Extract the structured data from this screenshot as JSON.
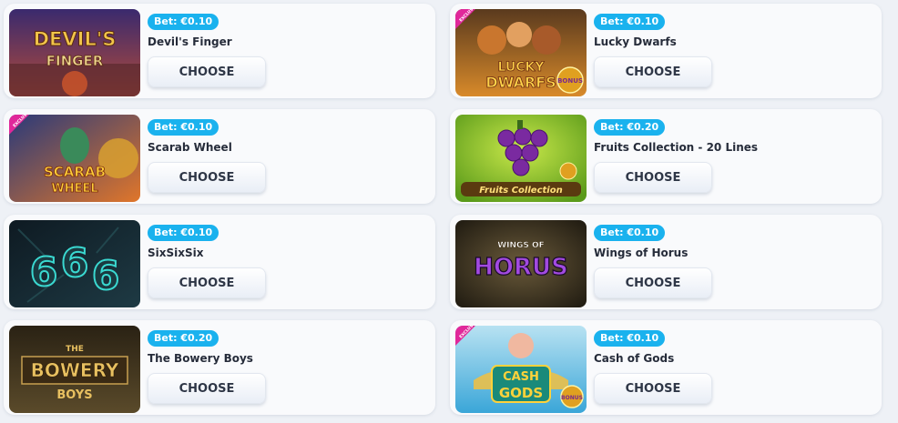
{
  "games": [
    {
      "bet": "Bet: €0.10",
      "title": "Devil's Finger",
      "button": "CHOOSE",
      "logo": [
        "DEVIL'S",
        "FINGER"
      ],
      "colors": {
        "bg1": "#3a2a6e",
        "bg2": "#b24a3a",
        "logo": "#f2c54a"
      }
    },
    {
      "bet": "Bet: €0.10",
      "title": "Lucky Dwarfs",
      "button": "CHOOSE",
      "logo": [
        "LUCKY",
        "DWARFS"
      ],
      "ribbon": "EXCLUSIVE",
      "corner": "BONUS",
      "colors": {
        "bg1": "#5a3a1e",
        "bg2": "#d88a2a",
        "logo": "#ffd24a"
      }
    },
    {
      "bet": "Bet: €0.10",
      "title": "Scarab Wheel",
      "button": "CHOOSE",
      "logo": [
        "SCARAB",
        "WHEEL"
      ],
      "ribbon": "EXCLUSIVE",
      "colors": {
        "bg1": "#2a3a7a",
        "bg2": "#e0762a",
        "logo": "#ffcf3a"
      }
    },
    {
      "bet": "Bet: €0.20",
      "title": "Fruits Collection - 20 Lines",
      "button": "CHOOSE",
      "logo": [
        "Fruits Collection"
      ],
      "colors": {
        "bg1": "#7ab82a",
        "bg2": "#c9e84a",
        "logo": "#ffe07a"
      }
    },
    {
      "bet": "Bet: €0.10",
      "title": "SixSixSix",
      "button": "CHOOSE",
      "logo": [
        "6",
        "6",
        "6"
      ],
      "colors": {
        "bg1": "#0e1a22",
        "bg2": "#1e3a44",
        "logo": "#3ad8d0"
      }
    },
    {
      "bet": "Bet: €0.10",
      "title": "Wings of Horus",
      "button": "CHOOSE",
      "logo": [
        "WINGS OF",
        "HORUS"
      ],
      "colors": {
        "bg1": "#2a2418",
        "bg2": "#6a5a3a",
        "logo": "#a24ae0"
      }
    },
    {
      "bet": "Bet: €0.20",
      "title": "The Bowery Boys",
      "button": "CHOOSE",
      "logo": [
        "THE",
        "BOWERY",
        "BOYS"
      ],
      "colors": {
        "bg1": "#2a2214",
        "bg2": "#5a4a2a",
        "logo": "#e8c060"
      }
    },
    {
      "bet": "Bet: €0.10",
      "title": "Cash of Gods",
      "button": "CHOOSE",
      "logo": [
        "CASH",
        "GODS"
      ],
      "ribbon": "EXCLUSIVE",
      "corner": "BONUS",
      "colors": {
        "bg1": "#3aa6d8",
        "bg2": "#b8e2f2",
        "logo": "#ffd23a"
      }
    }
  ]
}
